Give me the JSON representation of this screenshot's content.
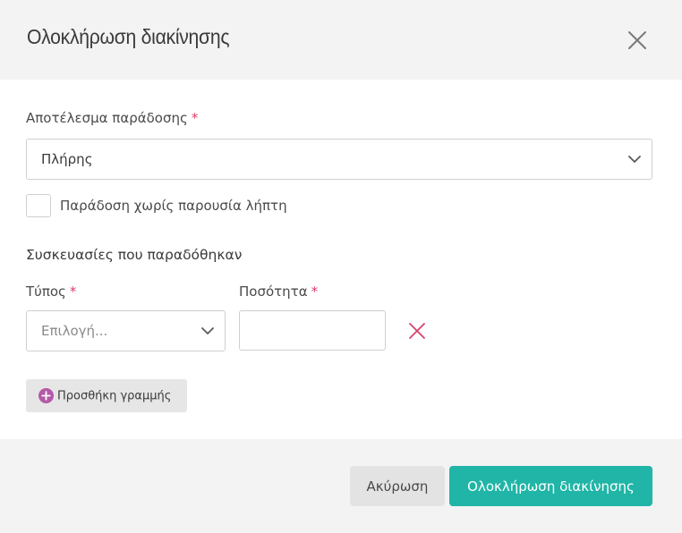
{
  "dialog": {
    "title": "Ολοκλήρωση διακίνησης"
  },
  "delivery_result": {
    "label": "Αποτέλεσμα παράδοσης",
    "required_mark": "*",
    "selected": "Πλήρης"
  },
  "no_recipient": {
    "label": "Παράδοση χωρίς παρουσία λήπτη",
    "checked": false
  },
  "packages": {
    "section_title": "Συσκευασίες που παραδόθηκαν",
    "type_label": "Τύπος",
    "type_required_mark": "*",
    "type_placeholder": "Επιλογή...",
    "quantity_label": "Ποσότητα",
    "quantity_required_mark": "*",
    "quantity_value": "",
    "add_line_label": "Προσθήκη γραμμής"
  },
  "footer": {
    "cancel_label": "Ακύρωση",
    "confirm_label": "Ολοκλήρωση διακίνησης"
  },
  "colors": {
    "accent": "#20b5a6",
    "required": "#d9416b",
    "add_icon": "#b45aa8",
    "remove_icon": "#d9416b"
  },
  "icons": {
    "close": "close-icon",
    "dropdown": "chevron-down-icon",
    "remove": "remove-row-icon",
    "add": "plus-circle-icon"
  }
}
